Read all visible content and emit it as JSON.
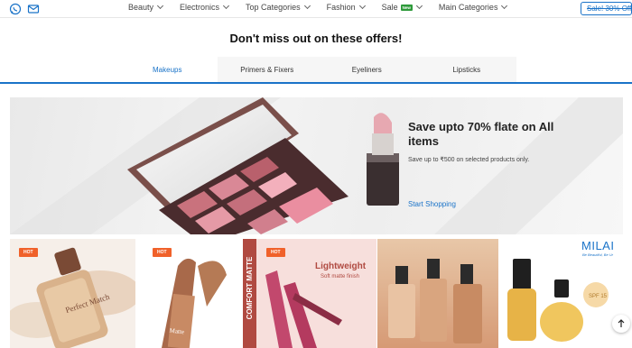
{
  "nav": {
    "items": [
      {
        "label": "Beauty"
      },
      {
        "label": "Electronics"
      },
      {
        "label": "Top Categories"
      },
      {
        "label": "Fashion"
      },
      {
        "label": "Sale",
        "badge": "New"
      },
      {
        "label": "Main Categories"
      }
    ],
    "sale_button": "Sale! 30% Off"
  },
  "section": {
    "heading": "Don't miss out on these offers!",
    "tabs": [
      "Makeups",
      "Primers & Fixers",
      "Eyeliners",
      "Lipsticks"
    ],
    "active_tab": "Makeups"
  },
  "banner": {
    "title": "Save upto 70% flate on All items",
    "subtitle": "Save up to ₹500 on selected products only.",
    "cta": "Start Shopping"
  },
  "products": {
    "hot_badge": "HOT",
    "comfort_matte": "COMFORT MATTE",
    "lightweight": "Lightweight",
    "soft_matte": "Soft matte finish",
    "brand": "MILAI",
    "tagline": "Be Beautiful, Be Ur",
    "spf": "SPF 15",
    "foundation_label": "Perfect Match",
    "lipstick_label": "Matte"
  },
  "colors": {
    "accent": "#1a73c8",
    "hot": "#f0612a",
    "new_badge": "#2e9a3a"
  }
}
